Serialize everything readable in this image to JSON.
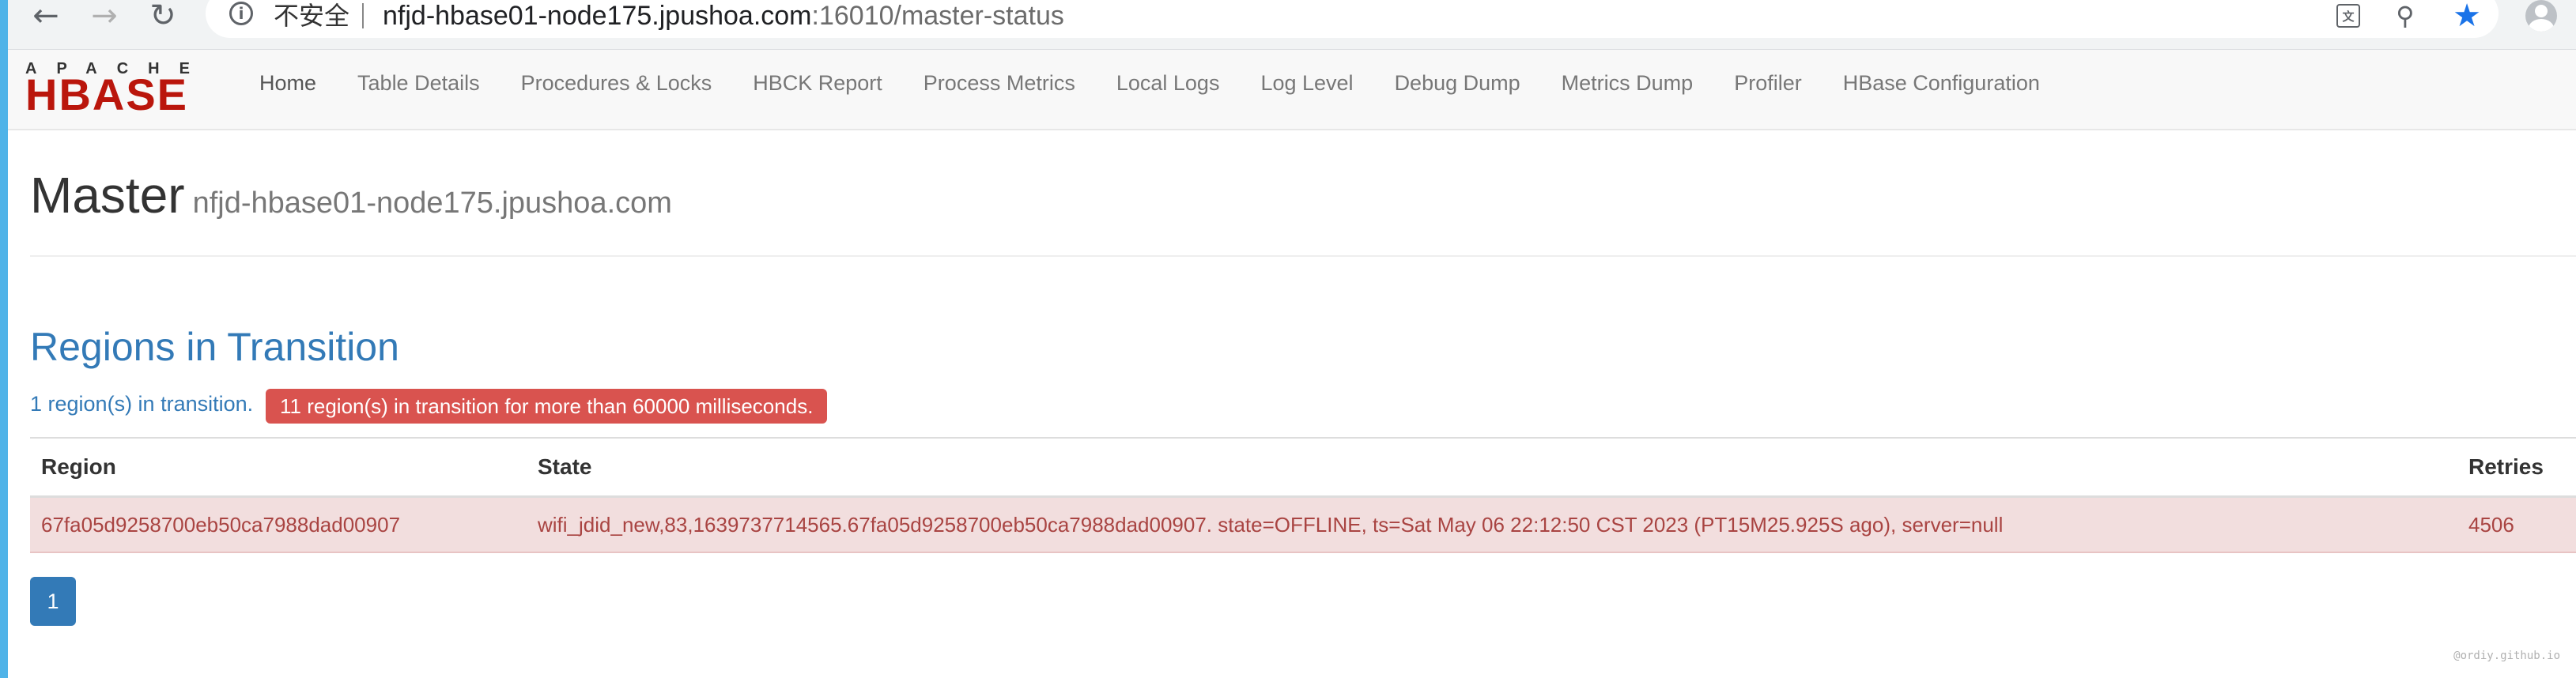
{
  "browser": {
    "nav": {
      "back_icon": "←",
      "forward_icon": "→",
      "reload_icon": "↻"
    },
    "security_label": "不安全",
    "url_host": "nfjd-hbase01-node175.jpushoa.com",
    "url_path": ":16010/master-status",
    "translate_glyph": "文",
    "zoom_glyph": "⚲",
    "star_glyph": "★"
  },
  "navbar": {
    "logo_top": "APACHE",
    "logo_main": "HBASE",
    "items": [
      {
        "label": "Home",
        "active": true
      },
      {
        "label": "Table Details"
      },
      {
        "label": "Procedures & Locks"
      },
      {
        "label": "HBCK Report"
      },
      {
        "label": "Process Metrics"
      },
      {
        "label": "Local Logs"
      },
      {
        "label": "Log Level"
      },
      {
        "label": "Debug Dump"
      },
      {
        "label": "Metrics Dump"
      },
      {
        "label": "Profiler"
      },
      {
        "label": "HBase Configuration"
      }
    ]
  },
  "header": {
    "title": "Master",
    "hostname": "nfjd-hbase01-node175.jpushoa.com"
  },
  "rit": {
    "title": "Regions in Transition",
    "count_text": "1 region(s) in transition.",
    "warning_badge": "11 region(s) in transition for more than 60000 milliseconds.",
    "columns": [
      "Region",
      "State",
      "Retries"
    ],
    "rows": [
      {
        "region": "67fa05d9258700eb50ca7988dad00907",
        "state": "wifi_jdid_new,83,1639737714565.67fa05d9258700eb50ca7988dad00907. state=OFFLINE, ts=Sat May 06 22:12:50 CST 2023 (PT15M25.925S ago), server=null",
        "retries": "4506"
      }
    ],
    "pagination": [
      "1"
    ]
  },
  "watermark": "@ordiy.github.io",
  "colors": {
    "accent": "#337ab7",
    "danger": "#d9534f",
    "row_bg": "#f2dede",
    "row_text": "#a94442",
    "logo_red": "#ba160c"
  }
}
